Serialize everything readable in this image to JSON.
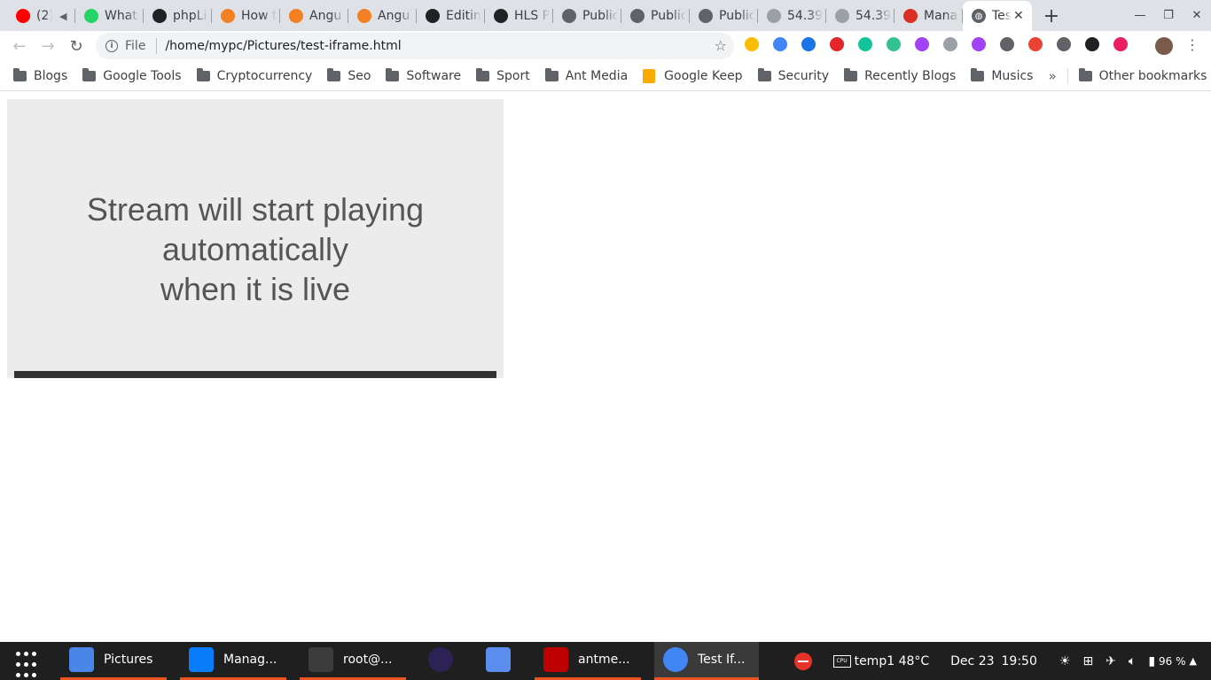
{
  "tabs": [
    {
      "title": "(2)",
      "icon": "youtube-icon",
      "color": "#ff0000",
      "audio": true
    },
    {
      "title": "What",
      "icon": "whatsapp-icon",
      "color": "#25d366"
    },
    {
      "title": "phpLi",
      "icon": "phpliteadmin-icon",
      "color": "#202124"
    },
    {
      "title": "How t",
      "icon": "stackoverflow-icon",
      "color": "#f48024"
    },
    {
      "title": "Angu",
      "icon": "stackoverflow-icon",
      "color": "#f48024"
    },
    {
      "title": "Angu",
      "icon": "stackoverflow-icon",
      "color": "#f48024"
    },
    {
      "title": "Editin",
      "icon": "github-icon",
      "color": "#202124"
    },
    {
      "title": "HLS P",
      "icon": "github-icon",
      "color": "#202124"
    },
    {
      "title": "Public",
      "icon": "globe-icon",
      "color": "#5f6368"
    },
    {
      "title": "Public",
      "icon": "globe-icon",
      "color": "#5f6368"
    },
    {
      "title": "Public",
      "icon": "globe-icon",
      "color": "#5f6368"
    },
    {
      "title": "54.39",
      "icon": "globe-icon",
      "color": "#9aa0a6"
    },
    {
      "title": "54.39",
      "icon": "globe-icon",
      "color": "#9aa0a6"
    },
    {
      "title": "Mana",
      "icon": "antmedia-icon",
      "color": "#d93025"
    }
  ],
  "active_tab": {
    "title": "Tes",
    "icon": "globe-icon",
    "close": "✕"
  },
  "new_tab": "+",
  "address_bar": {
    "scheme": "File",
    "url": "/home/mypc/Pictures/test-iframe.html"
  },
  "extensions": [
    {
      "icon": "keep-ext-icon",
      "color": "#fbbc04"
    },
    {
      "icon": "translate-ext-icon",
      "color": "#4285f4"
    },
    {
      "icon": "a-ext-icon",
      "color": "#1a73e8"
    },
    {
      "icon": "adblock-plus-icon",
      "color": "#e3262b"
    },
    {
      "icon": "grammarly-icon",
      "color": "#15c39a"
    },
    {
      "icon": "audio-ext-icon",
      "color": "#34c38f"
    },
    {
      "icon": "purple-ext-icon",
      "color": "#a142f4"
    },
    {
      "icon": "code-ext-icon",
      "color": "#9aa0a6"
    },
    {
      "icon": "pen-ext-icon",
      "color": "#a142f4"
    },
    {
      "icon": "c-ext-icon",
      "color": "#5f6368"
    },
    {
      "icon": "cookie-ext-icon",
      "color": "#ea4335"
    },
    {
      "icon": "film-ext-icon",
      "color": "#5f6368"
    },
    {
      "icon": "m-ext-icon",
      "color": "#202124"
    },
    {
      "icon": "heart-ext-icon",
      "color": "#e91e63"
    }
  ],
  "bookmarks": [
    {
      "label": "Blogs",
      "type": "folder"
    },
    {
      "label": "Google Tools",
      "type": "folder"
    },
    {
      "label": "Cryptocurrency",
      "type": "folder"
    },
    {
      "label": "Seo",
      "type": "folder"
    },
    {
      "label": "Software",
      "type": "folder"
    },
    {
      "label": "Sport",
      "type": "folder"
    },
    {
      "label": "Ant Media",
      "type": "folder"
    },
    {
      "label": "Google Keep",
      "type": "keep"
    },
    {
      "label": "Security",
      "type": "folder"
    },
    {
      "label": "Recently Blogs",
      "type": "folder"
    },
    {
      "label": "Musics",
      "type": "folder"
    }
  ],
  "bookmarks_overflow": "»",
  "other_bookmarks": "Other bookmarks",
  "player": {
    "message_lines": [
      "Stream will start playing",
      "automatically",
      "when it is live"
    ]
  },
  "taskbar": {
    "items": [
      {
        "label": "Pictures",
        "icon": "files-icon",
        "color": "#4a86e8"
      },
      {
        "label": "Manag...",
        "icon": "webstorm-icon",
        "color": "#087cfa"
      },
      {
        "label": "root@...",
        "icon": "terminal-icon",
        "color": "#3c3c3c"
      },
      {
        "label": "",
        "icon": "eclipse-icon",
        "color": "#2c2255"
      },
      {
        "label": "",
        "icon": "screenshot-icon",
        "color": "#5b8dee"
      },
      {
        "label": "antme...",
        "icon": "filezilla-icon",
        "color": "#bf0000"
      },
      {
        "label": "Test If...",
        "icon": "chrome-icon",
        "color": "#4285f4"
      }
    ],
    "temp": "temp1 48°C",
    "date": "Dec 23",
    "time": "19:50",
    "battery": "96 %"
  }
}
